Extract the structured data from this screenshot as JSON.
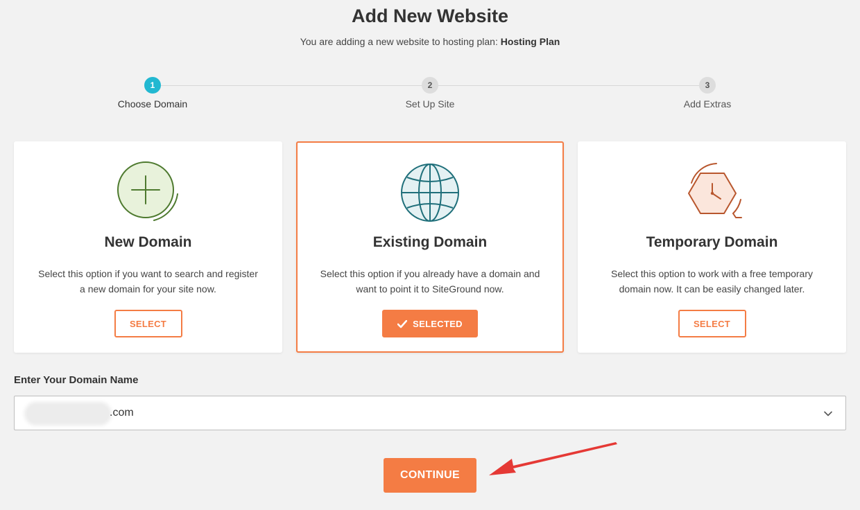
{
  "header": {
    "title": "Add New Website",
    "subtitle_prefix": "You are adding a new website to hosting plan:",
    "plan_name": "Hosting Plan"
  },
  "stepper": {
    "steps": [
      {
        "number": "1",
        "label": "Choose Domain",
        "state": "active"
      },
      {
        "number": "2",
        "label": "Set Up Site",
        "state": "inactive"
      },
      {
        "number": "3",
        "label": "Add Extras",
        "state": "inactive"
      }
    ]
  },
  "cards": [
    {
      "icon": "plus-circle-icon",
      "title": "New Domain",
      "description_line1": "Select this option if you want to search and register",
      "description_line2": "a new domain for your site now.",
      "button_label": "SELECT",
      "selected": false
    },
    {
      "icon": "globe-icon",
      "title": "Existing Domain",
      "description_line1": "Select this option if you already have a domain and",
      "description_line2": "want to point it to SiteGround now.",
      "button_label": "SELECTED",
      "selected": true
    },
    {
      "icon": "clock-hexagon-icon",
      "title": "Temporary Domain",
      "description_line1": "Select this option to work with a free temporary",
      "description_line2": "domain now. It can be easily changed later.",
      "button_label": "SELECT",
      "selected": false
    }
  ],
  "domain_field": {
    "label": "Enter Your Domain Name",
    "value_suffix": ".com"
  },
  "continue_label": "CONTINUE",
  "colors": {
    "accent": "#f47c44",
    "step_active": "#22b8d1",
    "new_domain_icon": "#4e7a2f",
    "existing_domain_icon": "#1f6f7a",
    "temporary_domain_icon": "#b8562d",
    "annotation_arrow": "#e53935"
  }
}
